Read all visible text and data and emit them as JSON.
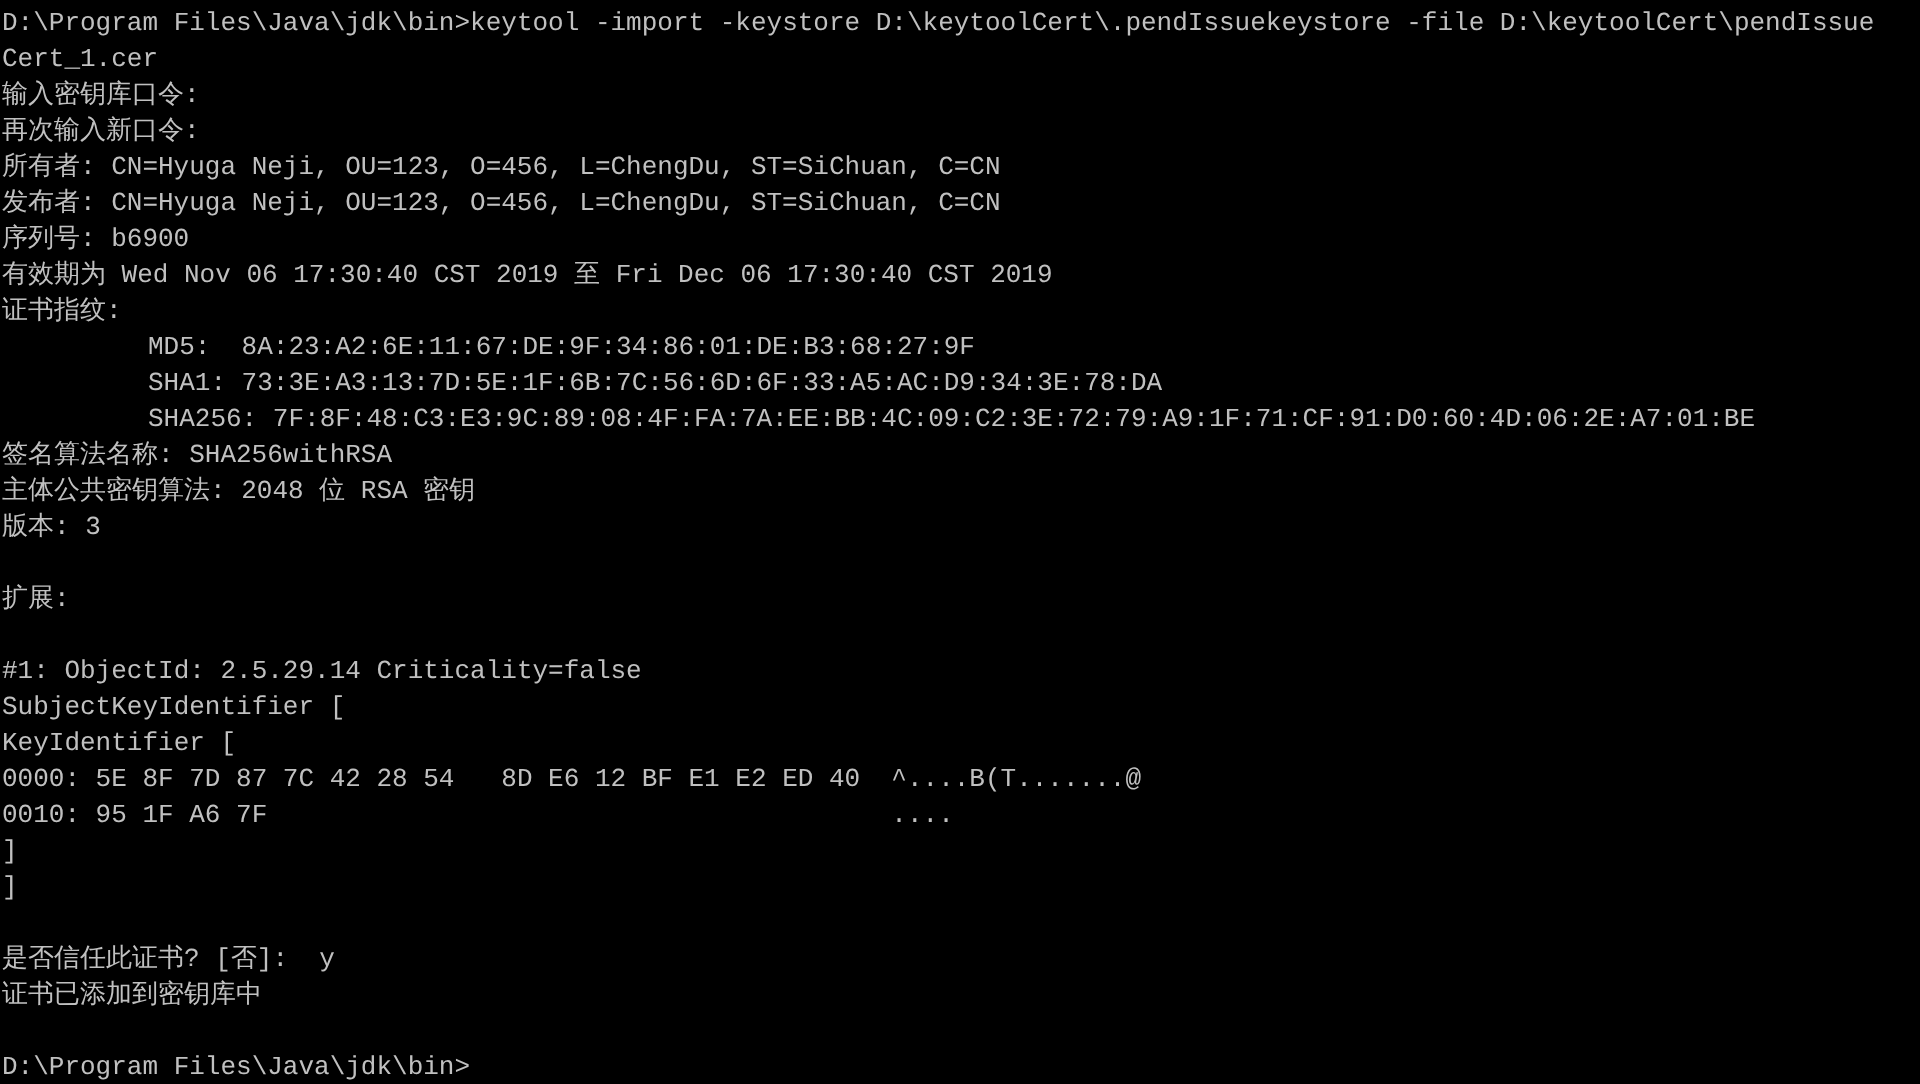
{
  "console": {
    "blocks": [
      {
        "lines": [
          {
            "kind": "plain",
            "text": "D:\\Program Files\\Java\\jdk\\bin>keytool -import -keystore D:\\keytoolCert\\.pendIssuekeystore -file D:\\keytoolCert\\pendIssue"
          },
          {
            "kind": "plain",
            "text": "Cert_1.cer"
          },
          {
            "kind": "plain",
            "text": "输入密钥库口令:"
          },
          {
            "kind": "plain",
            "text": "再次输入新口令:"
          },
          {
            "kind": "plain",
            "text": "所有者: CN=Hyuga Neji, OU=123, O=456, L=ChengDu, ST=SiChuan, C=CN"
          },
          {
            "kind": "plain",
            "text": "发布者: CN=Hyuga Neji, OU=123, O=456, L=ChengDu, ST=SiChuan, C=CN"
          },
          {
            "kind": "plain",
            "text": "序列号: b6900"
          },
          {
            "kind": "plain",
            "text": "有效期为 Wed Nov 06 17:30:40 CST 2019 至 Fri Dec 06 17:30:40 CST 2019"
          },
          {
            "kind": "plain",
            "text": "证书指纹:"
          },
          {
            "kind": "indented",
            "text": "MD5:  8A:23:A2:6E:11:67:DE:9F:34:86:01:DE:B3:68:27:9F"
          },
          {
            "kind": "indented",
            "text": "SHA1: 73:3E:A3:13:7D:5E:1F:6B:7C:56:6D:6F:33:A5:AC:D9:34:3E:78:DA"
          },
          {
            "kind": "indented",
            "text": "SHA256: 7F:8F:48:C3:E3:9C:89:08:4F:FA:7A:EE:BB:4C:09:C2:3E:72:79:A9:1F:71:CF:91:D0:60:4D:06:2E:A7:01:BE"
          },
          {
            "kind": "plain",
            "text": "签名算法名称: SHA256withRSA"
          },
          {
            "kind": "plain",
            "text": "主体公共密钥算法: 2048 位 RSA 密钥"
          },
          {
            "kind": "plain",
            "text": "版本: 3"
          }
        ]
      },
      {
        "lines": [
          {
            "kind": "plain",
            "text": "扩展:"
          }
        ]
      },
      {
        "lines": [
          {
            "kind": "plain",
            "text": "#1: ObjectId: 2.5.29.14 Criticality=false"
          },
          {
            "kind": "plain",
            "text": "SubjectKeyIdentifier ["
          },
          {
            "kind": "plain",
            "text": "KeyIdentifier ["
          },
          {
            "kind": "plain",
            "text": "0000: 5E 8F 7D 87 7C 42 28 54   8D E6 12 BF E1 E2 ED 40  ^....B(T.......@"
          },
          {
            "kind": "plain",
            "text": "0010: 95 1F A6 7F                                        ...."
          },
          {
            "kind": "plain",
            "text": "]"
          },
          {
            "kind": "plain",
            "text": "]"
          }
        ]
      },
      {
        "lines": [
          {
            "kind": "plain",
            "text": "是否信任此证书? [否]:  y"
          },
          {
            "kind": "plain",
            "text": "证书已添加到密钥库中"
          }
        ]
      },
      {
        "lines": [
          {
            "kind": "plain",
            "text": "D:\\Program Files\\Java\\jdk\\bin>"
          }
        ]
      }
    ]
  }
}
